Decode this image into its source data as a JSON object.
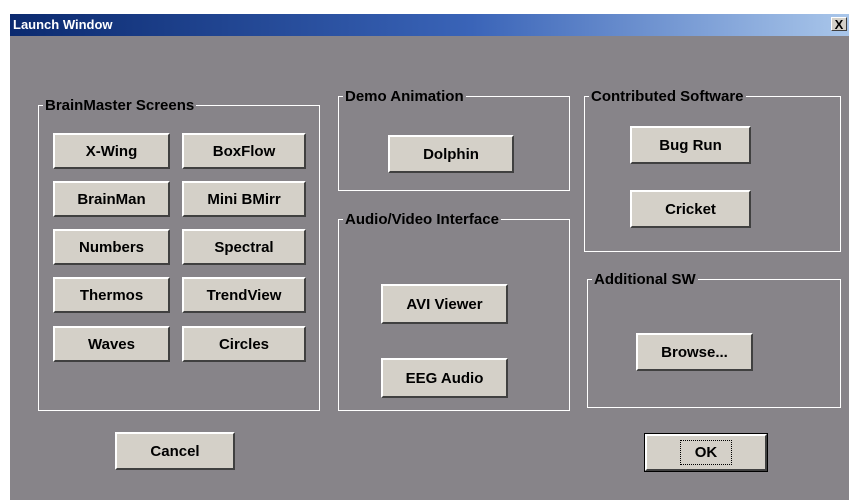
{
  "window": {
    "title": "Launch Window",
    "close_label": "X"
  },
  "groups": {
    "brainmaster": {
      "label": "BrainMaster Screens",
      "buttons": [
        "X-Wing",
        "BoxFlow",
        "BrainMan",
        "Mini BMirr",
        "Numbers",
        "Spectral",
        "Thermos",
        "TrendView",
        "Waves",
        "Circles"
      ]
    },
    "demo": {
      "label": "Demo Animation",
      "buttons": [
        "Dolphin"
      ]
    },
    "audio_video": {
      "label": "Audio/Video Interface",
      "buttons": [
        "AVI Viewer",
        "EEG Audio"
      ]
    },
    "contributed": {
      "label": "Contributed Software",
      "buttons": [
        "Bug Run",
        "Cricket"
      ]
    },
    "additional": {
      "label": "Additional SW",
      "buttons": [
        "Browse..."
      ]
    }
  },
  "actions": {
    "cancel": "Cancel",
    "ok": "OK"
  }
}
